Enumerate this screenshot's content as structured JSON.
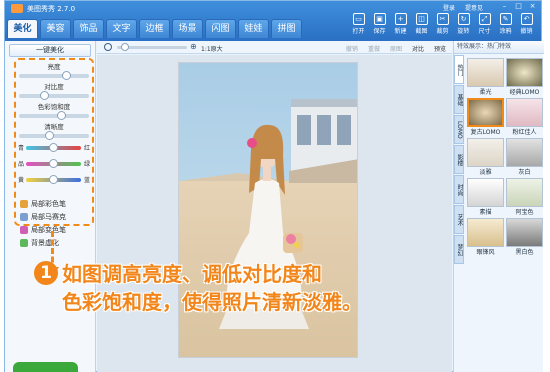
{
  "app": {
    "title": "美图秀秀 2.7.0",
    "tabs": [
      "美化",
      "美容",
      "饰品",
      "文字",
      "边框",
      "场景",
      "闪图",
      "娃娃",
      "拼图"
    ],
    "active_tab": "美化",
    "top_links": [
      "登录",
      "提意见"
    ],
    "toolbar": [
      {
        "label": "打开",
        "icon": "folder-icon"
      },
      {
        "label": "保存",
        "icon": "save-icon"
      },
      {
        "label": "新建",
        "icon": "new-icon"
      },
      {
        "label": "截图",
        "icon": "screenshot-icon"
      },
      {
        "label": "裁剪",
        "icon": "crop-icon"
      },
      {
        "label": "旋转",
        "icon": "rotate-icon"
      },
      {
        "label": "尺寸",
        "icon": "resize-icon"
      },
      {
        "label": "涂鸦",
        "icon": "doodle-icon"
      },
      {
        "label": "撤销",
        "icon": "undo-icon"
      }
    ]
  },
  "left_panel": {
    "onekey": "一键美化",
    "sliders": [
      {
        "label": "亮度",
        "value": 0.7
      },
      {
        "label": "对比度",
        "value": 0.35
      },
      {
        "label": "色彩饱和度",
        "value": 0.62
      },
      {
        "label": "清晰度",
        "value": 0.42
      }
    ],
    "rgb": [
      {
        "left": "青",
        "right": "红",
        "value": 0.5
      },
      {
        "left": "品",
        "right": "绿",
        "value": 0.5
      },
      {
        "left": "黄",
        "right": "蓝",
        "value": 0.5
      }
    ],
    "brushes": [
      "局部彩色笔",
      "局部马赛克",
      "局部变色笔",
      "背景虚化"
    ]
  },
  "edit_bar": {
    "zoom_text": "1:1原大",
    "tools": [
      "撤销",
      "重做",
      "原图",
      "对比",
      "预览"
    ]
  },
  "right_panel": {
    "head": "特效展示：热门特效",
    "vtabs": [
      "热门",
      "基础",
      "LOMO",
      "影楼",
      "时尚",
      "艺术",
      "梦幻"
    ],
    "effects": [
      {
        "name": "柔光"
      },
      {
        "name": "经典LOMO"
      },
      {
        "name": "复古LOMO"
      },
      {
        "name": "粉红佳人"
      },
      {
        "name": "淡雅"
      },
      {
        "name": "灰白"
      },
      {
        "name": "素描"
      },
      {
        "name": "阿宝色"
      },
      {
        "name": "眼锋风"
      },
      {
        "name": "黑白色"
      }
    ]
  },
  "callout": {
    "number": "1",
    "line1": "如图调高亮度、调低对比度和",
    "line2": "色彩饱和度，使得照片清新淡雅。"
  },
  "colors": {
    "accent": "#f08a18",
    "titlebar": "#2a70c4"
  }
}
